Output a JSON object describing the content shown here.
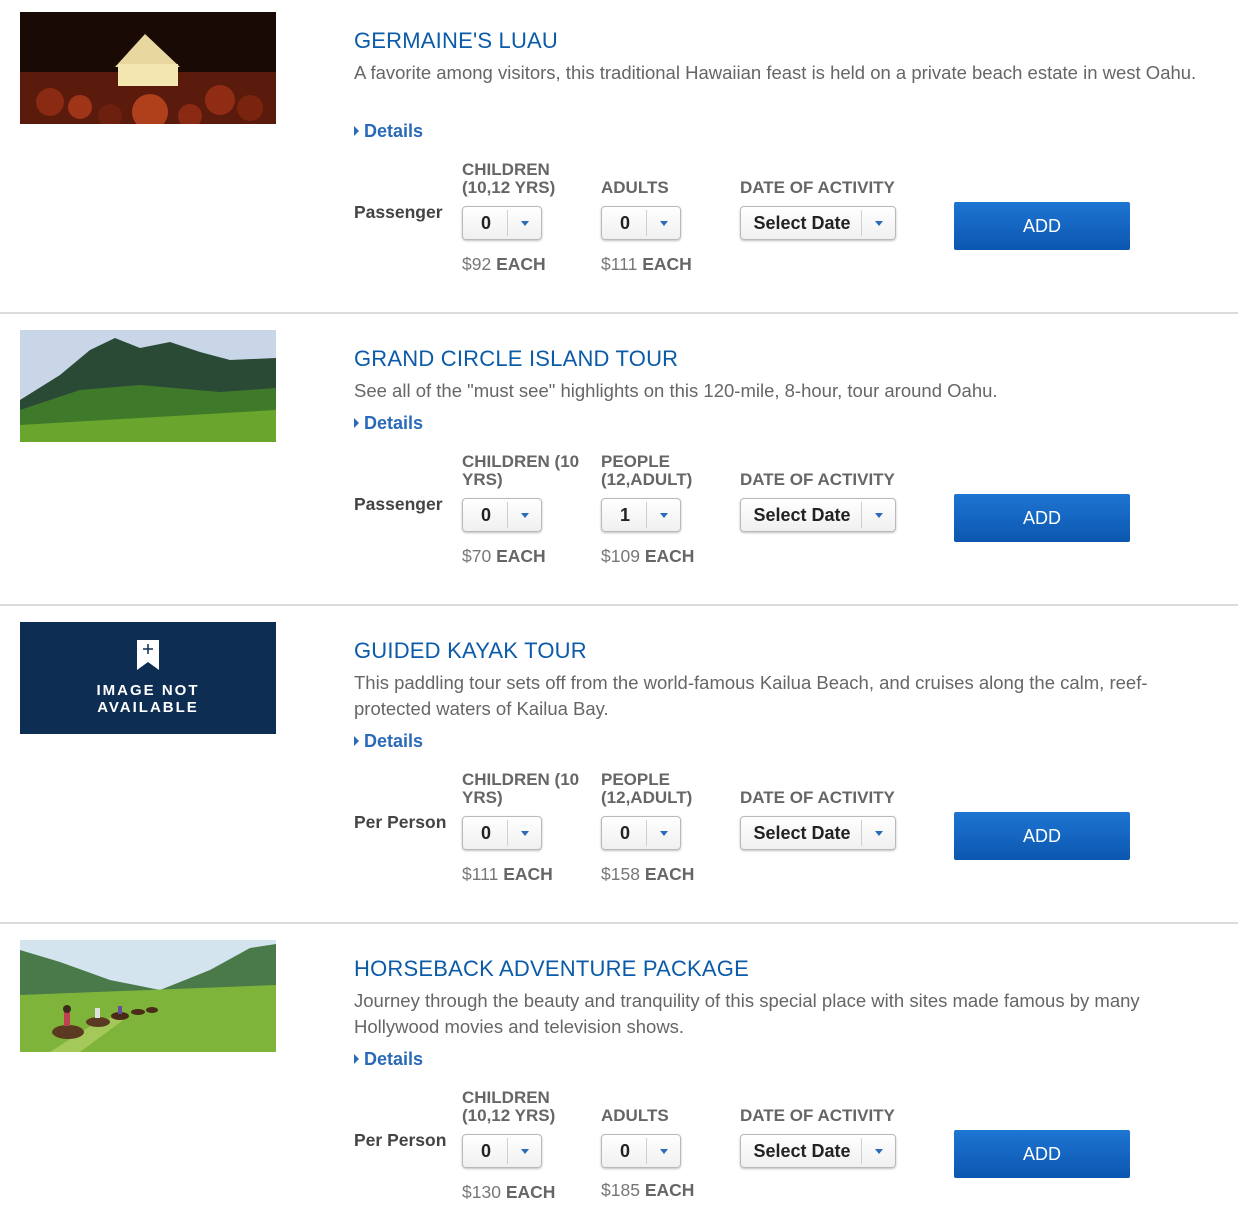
{
  "common": {
    "details_label": "Details",
    "date_header": "DATE OF ACTIVITY",
    "date_placeholder": "Select Date",
    "add_label": "ADD",
    "each_label": "EACH"
  },
  "activities": [
    {
      "title": "GERMAINE'S LUAU",
      "description": "A favorite among visitors, this traditional Hawaiian feast is held on a private beach estate in west Oahu.",
      "image": "luau-photo",
      "pricing_label": "Passenger",
      "children_header_1": "CHILDREN",
      "children_header_2": "(10,12 YRS)",
      "children_value": "0",
      "children_price": "$92",
      "adults_header_1": "",
      "adults_header_2": "ADULTS",
      "adults_value": "0",
      "adults_price": "$111"
    },
    {
      "title": "GRAND CIRCLE ISLAND TOUR",
      "description": "See all of the \"must see\" highlights on this 120-mile, 8-hour, tour around Oahu.",
      "image": "mountain-photo",
      "pricing_label": "Passenger",
      "children_header_1": "CHILDREN (10",
      "children_header_2": "YRS)",
      "children_value": "0",
      "children_price": "$70",
      "adults_header_1": "PEOPLE",
      "adults_header_2": "(12,ADULT)",
      "adults_value": "1",
      "adults_price": "$109"
    },
    {
      "title": "GUIDED KAYAK TOUR",
      "description": "This paddling tour sets off from the world-famous Kailua Beach, and cruises along the calm, reef-protected waters of Kailua Bay.",
      "image": "image-not-available",
      "image_text_1": "IMAGE NOT",
      "image_text_2": "AVAILABLE",
      "pricing_label": "Per Person",
      "children_header_1": "CHILDREN (10",
      "children_header_2": "YRS)",
      "children_value": "0",
      "children_price": "$111",
      "adults_header_1": "PEOPLE",
      "adults_header_2": "(12,ADULT)",
      "adults_value": "0",
      "adults_price": "$158"
    },
    {
      "title": "HORSEBACK ADVENTURE PACKAGE",
      "description": "Journey through the beauty and tranquility of this special place with sites made famous by many Hollywood movies and television shows.",
      "image": "horseback-photo",
      "pricing_label": "Per Person",
      "children_header_1": "CHILDREN",
      "children_header_2": "(10,12 YRS)",
      "children_value": "0",
      "children_price": "$130",
      "adults_header_1": "",
      "adults_header_2": "ADULTS",
      "adults_value": "0",
      "adults_price": "$185"
    }
  ],
  "colors": {
    "title": "#0b5ba8",
    "button": "#0b57b0",
    "placeholder_bg": "#0e2d52"
  }
}
